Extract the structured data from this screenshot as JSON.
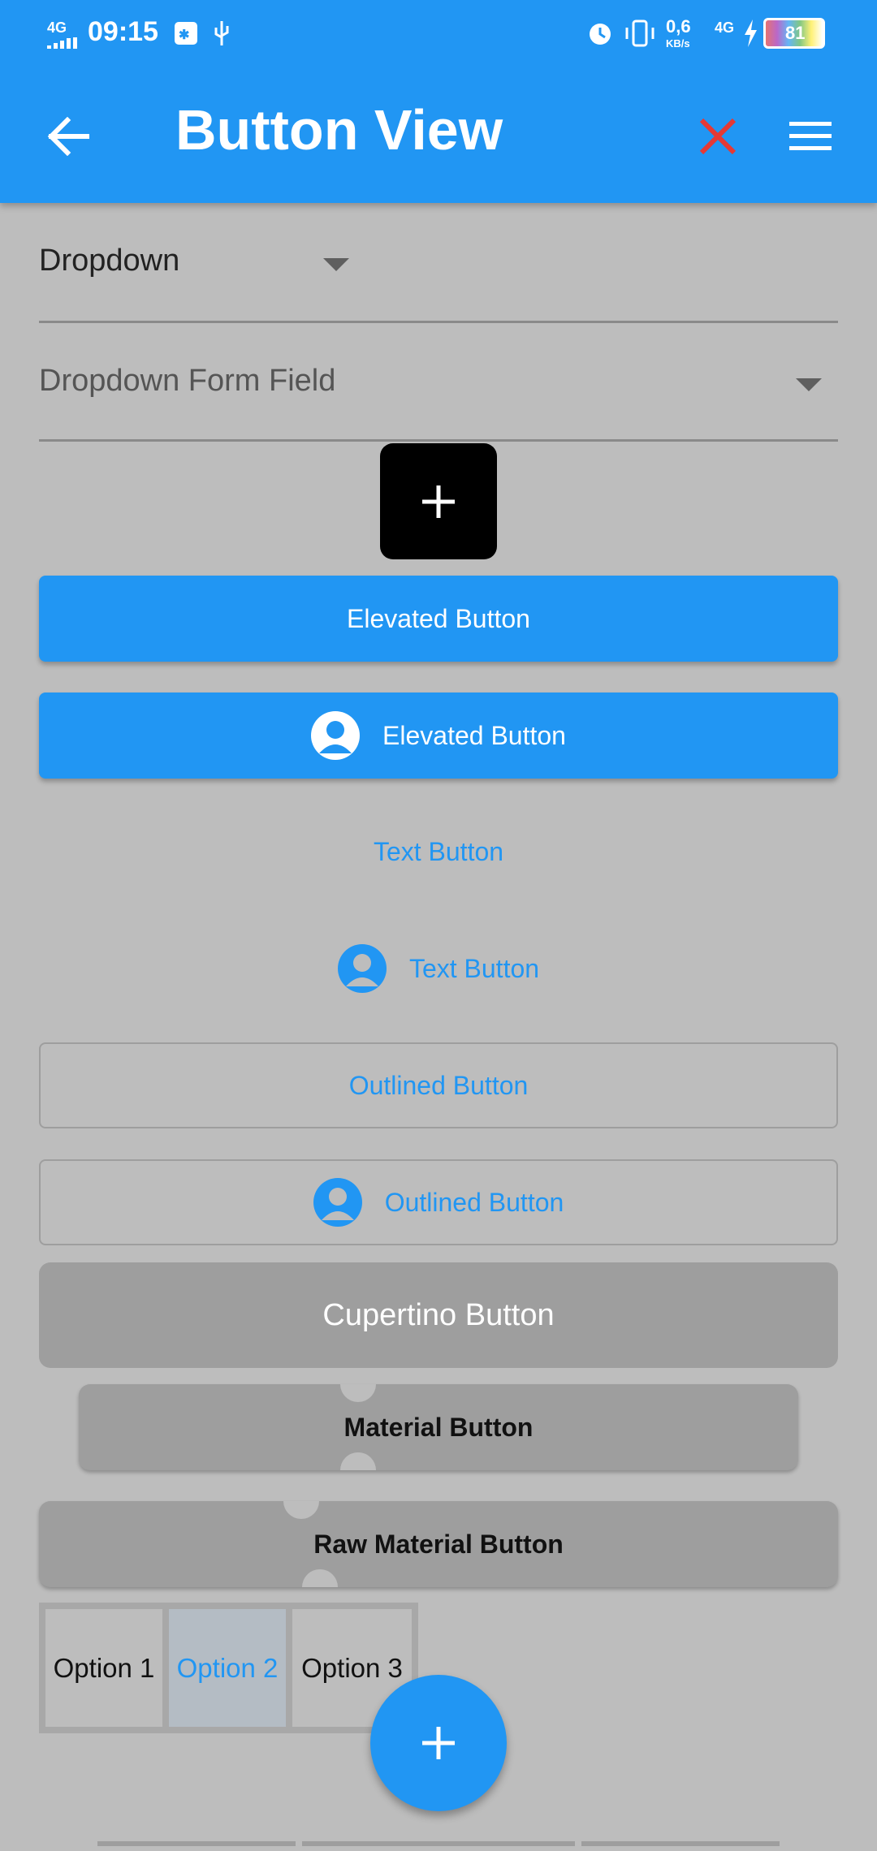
{
  "status_bar": {
    "time": "09:15",
    "network_left": "4G",
    "speed_value": "0,6",
    "speed_unit": "KB/s",
    "network_right": "4G",
    "battery": "81"
  },
  "app_bar": {
    "title": "Button View",
    "back_icon": "arrow-left-icon",
    "close_icon": "close-icon",
    "menu_icon": "menu-icon"
  },
  "dropdown": {
    "value": "Dropdown"
  },
  "dropdown_form_field": {
    "label": "Dropdown Form Field"
  },
  "buttons": {
    "elevated_1": "Elevated Button",
    "elevated_2": "Elevated Button",
    "text_1": "Text Button",
    "text_2": "Text Button",
    "outlined_1": "Outlined Button",
    "outlined_2": "Outlined Button",
    "cupertino": "Cupertino Button",
    "material": "Material Button",
    "raw_material": "Raw Material Button"
  },
  "toggle_buttons": {
    "options": [
      "Option 1",
      "Option 2",
      "Option 3"
    ],
    "selected": "Option 2"
  },
  "colors": {
    "primary": "#2196f3",
    "background": "#bdbdbd",
    "close": "#e53935"
  }
}
